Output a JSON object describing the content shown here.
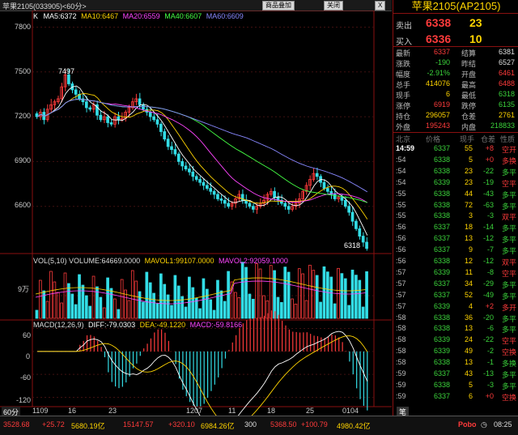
{
  "window": {
    "title": "苹果2105(033905)<60分>",
    "btn_add": "商品叠加",
    "btn_close": "关闭",
    "btn_x": "X"
  },
  "chart": {
    "ma_labels": {
      "k": "K",
      "ma5": "MA5:6372",
      "ma10": "MA10:6467",
      "ma20": "MA20:6559",
      "ma40": "MA40:6607",
      "ma60": "MA60:6609"
    },
    "price_ticks": [
      "7800",
      "7500",
      "7200",
      "6900",
      "6600"
    ],
    "high_label": "7497",
    "low_label": "6318",
    "vol_label": "VOL(5,10) VOLUME:64669.0000",
    "mavol1": "MAVOL1:99107.0000",
    "mavol2": "MAVOL2:92059.1000",
    "vol_tick": "9万",
    "macd_label": "MACD(12,26,9)",
    "diff": "DIFF:-79.0303",
    "dea": "DEA:-49.1220",
    "macd_val": "MACD:-59.8166",
    "macd_ticks": [
      "60",
      "0",
      "-60",
      "-120"
    ],
    "period_label": "60分",
    "date_ticks": [
      "1109",
      "16",
      "23",
      "1207",
      "11",
      "18",
      "25",
      "0104"
    ],
    "colors": {
      "up": "#ff3b3b",
      "down": "#33dde6",
      "ma5": "#ffffff",
      "ma10": "#ffd400",
      "ma20": "#ff44ff",
      "ma40": "#44ff44",
      "ma60": "#8888ff"
    }
  },
  "chart_data": {
    "type": "candlestick",
    "price_axis": [
      6300,
      7900
    ],
    "close_series": [
      7200,
      7230,
      7180,
      7250,
      7280,
      7300,
      7320,
      7400,
      7480,
      7420,
      7380,
      7350,
      7320,
      7300,
      7260,
      7250,
      7280,
      7210,
      7180,
      7200,
      7160,
      7150,
      7200,
      7180,
      7190,
      7230,
      7260,
      7300,
      7320,
      7280,
      7250,
      7230,
      7200,
      7180,
      7150,
      7100,
      7050,
      7000,
      6980,
      6950,
      6900,
      6870,
      6850,
      6830,
      6800,
      6780,
      6760,
      6740,
      6720,
      6700,
      6680,
      6650,
      6640,
      6620,
      6600,
      6620,
      6650,
      6680,
      6640,
      6620,
      6600,
      6580,
      6600,
      6620,
      6640,
      6680,
      6700,
      6660,
      6640,
      6620,
      6600,
      6580,
      6600,
      6620,
      6650,
      6700,
      6740,
      6780,
      6820,
      6800,
      6760,
      6720,
      6700,
      6680,
      6650,
      6660,
      6640,
      6600,
      6560,
      6500,
      6450,
      6400,
      6360,
      6318
    ],
    "volume_axis_mark": 90000,
    "macd_axis": [
      -140,
      80
    ],
    "diff_last": -79.0303,
    "dea_last": -49.122,
    "macd_last": -59.8166
  },
  "side": {
    "title": "苹果2105(AP2105)",
    "sell_label": "卖出",
    "sell_price": "6338",
    "sell_qty": "23",
    "buy_label": "买入",
    "buy_price": "6336",
    "buy_qty": "10",
    "quotes": [
      {
        "l1": "最新",
        "v1": "6337",
        "c1": "r",
        "l2": "结算",
        "v2": "6381",
        "c2": "w"
      },
      {
        "l1": "涨跌",
        "v1": "-190",
        "c1": "g",
        "l2": "昨结",
        "v2": "6527",
        "c2": "w"
      },
      {
        "l1": "幅度",
        "v1": "-2.91%",
        "c1": "g",
        "l2": "开盘",
        "v2": "6461",
        "c2": "r"
      },
      {
        "l1": "总手",
        "v1": "414076",
        "c1": "y",
        "l2": "最高",
        "v2": "6488",
        "c2": "r"
      },
      {
        "l1": "现手",
        "v1": "6",
        "c1": "y",
        "l2": "最低",
        "v2": "6318",
        "c2": "g"
      },
      {
        "l1": "涨停",
        "v1": "6919",
        "c1": "r",
        "l2": "跌停",
        "v2": "6135",
        "c2": "g"
      },
      {
        "l1": "持仓",
        "v1": "296057",
        "c1": "y",
        "l2": "仓差",
        "v2": "2761",
        "c2": "y"
      },
      {
        "l1": "外盘",
        "v1": "195243",
        "c1": "r",
        "l2": "内盘",
        "v2": "218833",
        "c2": "g"
      }
    ],
    "tick_header": [
      "北京",
      "价格",
      "现手",
      "仓差",
      "性质"
    ],
    "ticks": [
      {
        "t": "14:59",
        "p": "6337",
        "v": "55",
        "o": "+8",
        "oc": "r",
        "n": "空开",
        "nc": "r"
      },
      {
        "t": ":54",
        "p": "6338",
        "v": "5",
        "o": "+0",
        "oc": "r",
        "n": "多换",
        "nc": "r"
      },
      {
        "t": ":54",
        "p": "6338",
        "v": "23",
        "o": "-22",
        "oc": "g",
        "n": "多平",
        "nc": "g"
      },
      {
        "t": ":54",
        "p": "6339",
        "v": "23",
        "o": "-19",
        "oc": "g",
        "n": "空平",
        "nc": "r"
      },
      {
        "t": ":55",
        "p": "6338",
        "v": "44",
        "o": "-43",
        "oc": "g",
        "n": "多平",
        "nc": "g"
      },
      {
        "t": ":55",
        "p": "6338",
        "v": "72",
        "o": "-63",
        "oc": "g",
        "n": "多平",
        "nc": "g"
      },
      {
        "t": ":55",
        "p": "6338",
        "v": "3",
        "o": "-3",
        "oc": "g",
        "n": "双平",
        "nc": "r"
      },
      {
        "t": ":56",
        "p": "6337",
        "v": "18",
        "o": "-14",
        "oc": "g",
        "n": "多平",
        "nc": "g"
      },
      {
        "t": ":56",
        "p": "6337",
        "v": "13",
        "o": "-12",
        "oc": "g",
        "n": "多平",
        "nc": "g"
      },
      {
        "t": ":56",
        "p": "6337",
        "v": "9",
        "o": "-7",
        "oc": "g",
        "n": "多平",
        "nc": "g"
      },
      {
        "t": ":56",
        "p": "6338",
        "v": "12",
        "o": "-12",
        "oc": "g",
        "n": "双平",
        "nc": "r"
      },
      {
        "t": ":57",
        "p": "6339",
        "v": "11",
        "o": "-8",
        "oc": "g",
        "n": "空平",
        "nc": "r"
      },
      {
        "t": ":57",
        "p": "6337",
        "v": "34",
        "o": "-29",
        "oc": "g",
        "n": "多平",
        "nc": "g"
      },
      {
        "t": ":57",
        "p": "6337",
        "v": "52",
        "o": "-49",
        "oc": "g",
        "n": "多平",
        "nc": "g"
      },
      {
        "t": ":57",
        "p": "6339",
        "v": "4",
        "o": "+2",
        "oc": "r",
        "n": "多开",
        "nc": "r"
      },
      {
        "t": ":58",
        "p": "6338",
        "v": "36",
        "o": "-20",
        "oc": "g",
        "n": "多平",
        "nc": "g"
      },
      {
        "t": ":58",
        "p": "6338",
        "v": "13",
        "o": "-6",
        "oc": "g",
        "n": "多平",
        "nc": "g"
      },
      {
        "t": ":58",
        "p": "6339",
        "v": "24",
        "o": "-22",
        "oc": "g",
        "n": "空平",
        "nc": "r"
      },
      {
        "t": ":58",
        "p": "6339",
        "v": "49",
        "o": "-2",
        "oc": "g",
        "n": "空换",
        "nc": "r"
      },
      {
        "t": ":58",
        "p": "6338",
        "v": "13",
        "o": "-1",
        "oc": "g",
        "n": "多换",
        "nc": "g"
      },
      {
        "t": ":59",
        "p": "6337",
        "v": "43",
        "o": "-13",
        "oc": "g",
        "n": "多平",
        "nc": "g"
      },
      {
        "t": ":59",
        "p": "6338",
        "v": "5",
        "o": "-3",
        "oc": "g",
        "n": "多平",
        "nc": "g"
      },
      {
        "t": ":59",
        "p": "6337",
        "v": "6",
        "o": "+0",
        "oc": "r",
        "n": "空换",
        "nc": "r"
      }
    ],
    "tab": "笔"
  },
  "statusbar": [
    {
      "v": "3528.68",
      "c": "r"
    },
    {
      "v": "+25.72",
      "c": "r"
    },
    {
      "v": "5680.19亿",
      "c": "y"
    },
    {
      "v": "15147.57",
      "c": "r"
    },
    {
      "v": "+320.10",
      "c": "r"
    },
    {
      "v": "6984.26亿",
      "c": "y"
    },
    {
      "v": "300",
      "c": "w"
    },
    {
      "v": "5368.50",
      "c": "r"
    },
    {
      "v": "+100.79",
      "c": "r"
    },
    {
      "v": "4980.42亿",
      "c": "y"
    }
  ],
  "status_logo": "Pobo",
  "status_time": "08:25"
}
